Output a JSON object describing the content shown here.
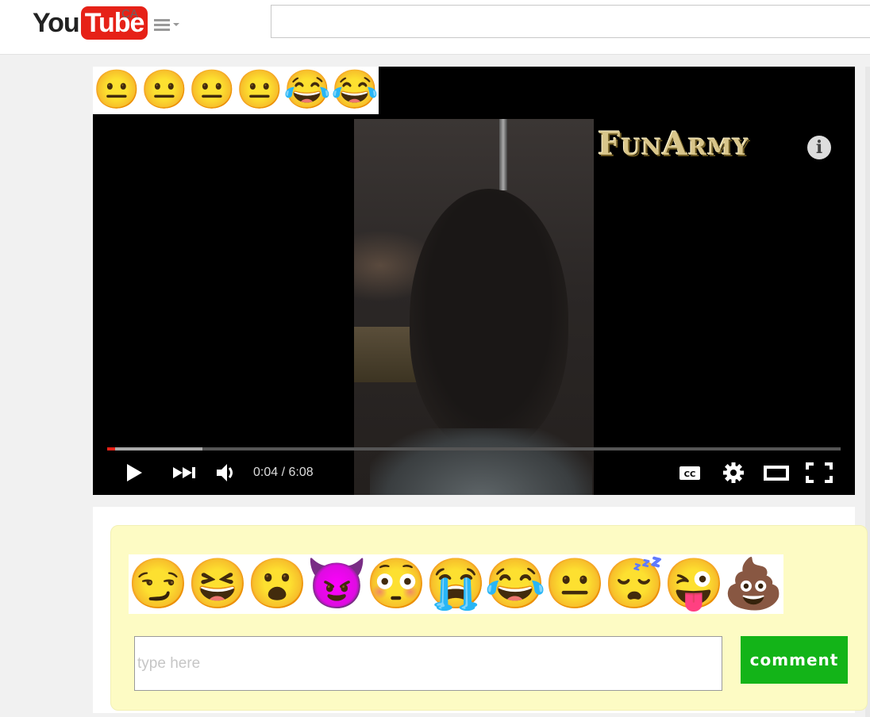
{
  "header": {
    "logo_you": "You",
    "logo_tube": "Tube",
    "region": "CA",
    "search_placeholder": ""
  },
  "player": {
    "reaction_strip": [
      "😐",
      "😐",
      "😐",
      "😐",
      "😂",
      "😂"
    ],
    "watermark": "FunArmy",
    "info_label": "i",
    "time_current": "0:04",
    "time_separator": " / ",
    "time_total": "6:08",
    "progress_played_fraction": 0.011,
    "progress_buffered_fraction": 0.13,
    "cc_label": "CC"
  },
  "comment": {
    "reactions": [
      {
        "icon": "rage-face-challenge-accepted-icon",
        "glyph": "😏"
      },
      {
        "icon": "rage-face-laughing-icon",
        "glyph": "😆"
      },
      {
        "icon": "rage-face-surprised-icon",
        "glyph": "😮"
      },
      {
        "icon": "troll-face-icon",
        "glyph": "😈"
      },
      {
        "icon": "rage-face-wide-eyed-icon",
        "glyph": "😳"
      },
      {
        "icon": "crying-face-icon",
        "glyph": "😭"
      },
      {
        "icon": "tears-of-joy-icon",
        "glyph": "😂"
      },
      {
        "icon": "neutral-face-icon",
        "glyph": "😐"
      },
      {
        "icon": "sleeping-face-icon",
        "glyph": "😴"
      },
      {
        "icon": "winking-tongue-face-icon",
        "glyph": "😜"
      },
      {
        "icon": "flaming-poop-icon",
        "glyph": "💩"
      }
    ],
    "input_placeholder": "type here",
    "button_label": "comment"
  },
  "colors": {
    "brand_red": "#e62117",
    "comment_button": "#13b418",
    "comment_area_bg": "#fdfbc4"
  }
}
